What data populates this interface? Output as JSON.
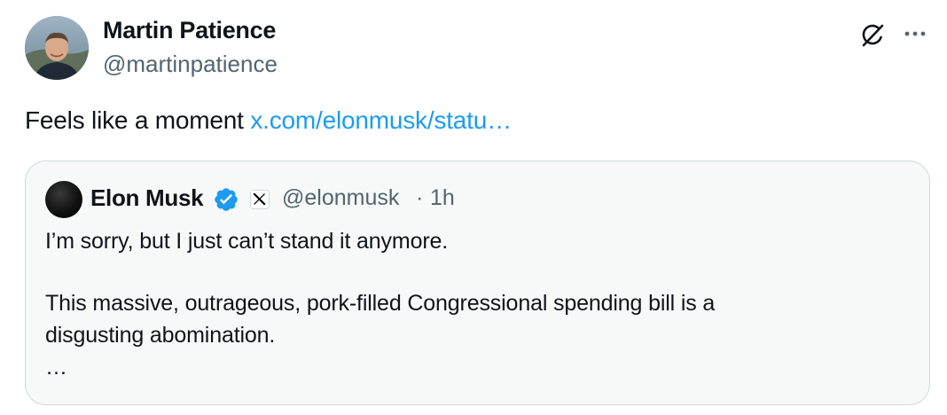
{
  "author": {
    "name": "Martin Patience",
    "handle": "@martinpatience"
  },
  "header_actions": {
    "grok_icon": "grok-icon",
    "more_icon": "more-icon"
  },
  "tweet": {
    "text": "Feels like a moment ",
    "link_text": "x.com/elonmusk/statu…"
  },
  "quote": {
    "name": "Elon Musk",
    "verified_icon": "verified-badge-icon",
    "affiliation_icon": "x-logo-icon",
    "handle": "@elonmusk",
    "separator": "·",
    "time": "1h",
    "lines": [
      "I’m sorry, but I just can’t stand it anymore.",
      "This massive, outrageous, pork-filled Congressional spending bill is a",
      "disgusting abomination.",
      "…"
    ]
  },
  "colors": {
    "link": "#1d9bf0",
    "verified": "#1d9bf0",
    "secondary_text": "#536471",
    "card_background": "#f7f9f9",
    "card_border": "#cfd9de"
  }
}
